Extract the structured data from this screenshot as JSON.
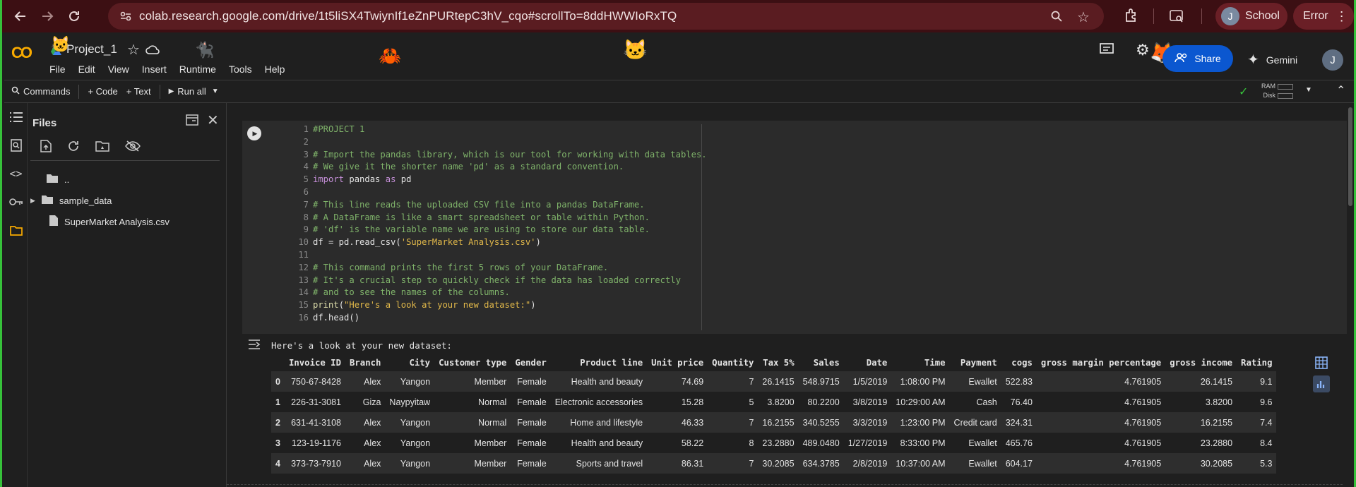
{
  "browser": {
    "url": "colab.research.google.com/drive/1t5liSX4TwiynIf1eZnPURtepC3hV_cqo#scrollTo=8ddHWWIoRxTQ",
    "profile_initial": "J",
    "profile_label": "School",
    "error_label": "Error"
  },
  "colab": {
    "logo": "CO",
    "notebook_title": "Project_1",
    "menu": [
      "File",
      "Edit",
      "View",
      "Insert",
      "Runtime",
      "Tools",
      "Help"
    ],
    "share_label": "Share",
    "gemini_label": "Gemini",
    "account_initial": "J",
    "ram_label": "RAM",
    "disk_label": "Disk"
  },
  "toolbar": {
    "commands_label": "Commands",
    "code_label": "+ Code",
    "text_label": "+ Text",
    "run_all_label": "Run all"
  },
  "files_panel": {
    "title": "Files",
    "items": [
      {
        "name": "..",
        "type": "folder"
      },
      {
        "name": "sample_data",
        "type": "folder"
      },
      {
        "name": "SuperMarket Analysis.csv",
        "type": "file"
      }
    ]
  },
  "code_cell": {
    "lines": [
      {
        "n": "1",
        "segs": [
          {
            "c": "cm",
            "t": "#PROJECT 1"
          }
        ]
      },
      {
        "n": "2",
        "segs": []
      },
      {
        "n": "3",
        "segs": [
          {
            "c": "cm",
            "t": "# Import the pandas library, which is our tool for working with data tables."
          }
        ]
      },
      {
        "n": "4",
        "segs": [
          {
            "c": "cm",
            "t": "# We give it the shorter name 'pd' as a standard convention."
          }
        ]
      },
      {
        "n": "5",
        "segs": [
          {
            "c": "kw",
            "t": "import"
          },
          {
            "c": "tx",
            "t": " pandas "
          },
          {
            "c": "kw",
            "t": "as"
          },
          {
            "c": "tx",
            "t": " pd"
          }
        ]
      },
      {
        "n": "6",
        "segs": []
      },
      {
        "n": "7",
        "segs": [
          {
            "c": "cm",
            "t": "# This line reads the uploaded CSV file into a pandas DataFrame."
          }
        ]
      },
      {
        "n": "8",
        "segs": [
          {
            "c": "cm",
            "t": "# A DataFrame is like a smart spreadsheet or table within Python."
          }
        ]
      },
      {
        "n": "9",
        "segs": [
          {
            "c": "cm",
            "t": "# 'df' is the variable name we are using to store our data table."
          }
        ]
      },
      {
        "n": "10",
        "segs": [
          {
            "c": "tx",
            "t": "df = pd.read_csv("
          },
          {
            "c": "st",
            "t": "'SuperMarket Analysis.csv'"
          },
          {
            "c": "tx",
            "t": ")"
          }
        ]
      },
      {
        "n": "11",
        "segs": []
      },
      {
        "n": "12",
        "segs": [
          {
            "c": "cm",
            "t": "# This command prints the first 5 rows of your DataFrame."
          }
        ]
      },
      {
        "n": "13",
        "segs": [
          {
            "c": "cm",
            "t": "# It's a crucial step to quickly check if the data has loaded correctly"
          }
        ]
      },
      {
        "n": "14",
        "segs": [
          {
            "c": "cm",
            "t": "# and to see the names of the columns."
          }
        ]
      },
      {
        "n": "15",
        "segs": [
          {
            "c": "fn",
            "t": "print"
          },
          {
            "c": "tx",
            "t": "("
          },
          {
            "c": "st",
            "t": "\"Here's a look at your new dataset:\""
          },
          {
            "c": "tx",
            "t": ")"
          }
        ]
      },
      {
        "n": "16",
        "segs": [
          {
            "c": "tx",
            "t": "df.head()"
          }
        ]
      }
    ]
  },
  "output": {
    "printed": "Here's a look at your new dataset:",
    "columns": [
      "",
      "Invoice ID",
      "Branch",
      "City",
      "Customer type",
      "Gender",
      "Product line",
      "Unit price",
      "Quantity",
      "Tax 5%",
      "Sales",
      "Date",
      "Time",
      "Payment",
      "cogs",
      "gross margin percentage",
      "gross income",
      "Rating"
    ],
    "rows": [
      [
        "0",
        "750-67-8428",
        "Alex",
        "Yangon",
        "Member",
        "Female",
        "Health and beauty",
        "74.69",
        "7",
        "26.1415",
        "548.9715",
        "1/5/2019",
        "1:08:00 PM",
        "Ewallet",
        "522.83",
        "4.761905",
        "26.1415",
        "9.1"
      ],
      [
        "1",
        "226-31-3081",
        "Giza",
        "Naypyitaw",
        "Normal",
        "Female",
        "Electronic accessories",
        "15.28",
        "5",
        "3.8200",
        "80.2200",
        "3/8/2019",
        "10:29:00 AM",
        "Cash",
        "76.40",
        "4.761905",
        "3.8200",
        "9.6"
      ],
      [
        "2",
        "631-41-3108",
        "Alex",
        "Yangon",
        "Normal",
        "Female",
        "Home and lifestyle",
        "46.33",
        "7",
        "16.2155",
        "340.5255",
        "3/3/2019",
        "1:23:00 PM",
        "Credit card",
        "324.31",
        "4.761905",
        "16.2155",
        "7.4"
      ],
      [
        "3",
        "123-19-1176",
        "Alex",
        "Yangon",
        "Member",
        "Female",
        "Health and beauty",
        "58.22",
        "8",
        "23.2880",
        "489.0480",
        "1/27/2019",
        "8:33:00 PM",
        "Ewallet",
        "465.76",
        "4.761905",
        "23.2880",
        "8.4"
      ],
      [
        "4",
        "373-73-7910",
        "Alex",
        "Yangon",
        "Member",
        "Female",
        "Sports and travel",
        "86.31",
        "7",
        "30.2085",
        "634.3785",
        "2/8/2019",
        "10:37:00 AM",
        "Ewallet",
        "604.17",
        "4.761905",
        "30.2085",
        "5.3"
      ]
    ]
  },
  "colors": {
    "accent_green": "#36c13a",
    "share_blue": "#0b57d0",
    "logo_orange": "#f9ab00",
    "chrome_red": "#3c0f13"
  }
}
